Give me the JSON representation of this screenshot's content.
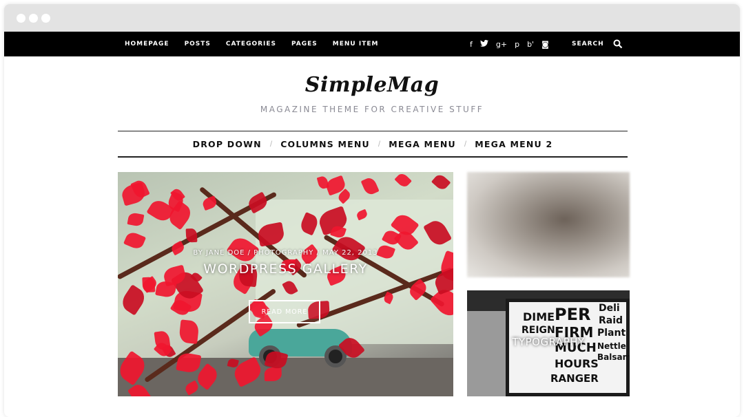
{
  "topbar": {
    "nav": [
      "HOMEPAGE",
      "POSTS",
      "CATEGORIES",
      "PAGES",
      "MENU ITEM"
    ],
    "social": [
      {
        "name": "facebook-icon",
        "glyph": "f"
      },
      {
        "name": "twitter-icon",
        "glyph": "t"
      },
      {
        "name": "google-plus-icon",
        "glyph": "g+"
      },
      {
        "name": "pinterest-icon",
        "glyph": "p"
      },
      {
        "name": "behance-icon",
        "glyph": "b'"
      },
      {
        "name": "instagram-icon",
        "glyph": "◙"
      }
    ],
    "search_label": "SEARCH"
  },
  "header": {
    "logo": "SimpleMag",
    "tagline": "MAGAZINE THEME FOR CREATIVE STUFF"
  },
  "main_nav": [
    "DROP DOWN",
    "COLUMNS MENU",
    "MEGA MENU",
    "MEGA MENU 2"
  ],
  "feature": {
    "meta": "BY JANE DOE  /  PHOTOGRAPHY  /  MAY 22, 2013",
    "title": "WORDPRESS GALLERY",
    "button": "READ MORE"
  },
  "side_posts": [
    {
      "label": ""
    },
    {
      "label": "TYPOGRAPHY",
      "poster_words": [
        "DIME",
        "PER",
        "Deli",
        "REIGN",
        "FIRM",
        "Raid",
        "MUCH",
        "Plant",
        "HOURS",
        "Nettle",
        "RANGER",
        "Balsam"
      ]
    }
  ]
}
